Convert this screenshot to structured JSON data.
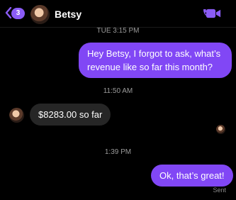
{
  "header": {
    "unread_count": "3",
    "contact_name": "Betsy"
  },
  "messages": [
    {
      "type": "timestamp",
      "text": "TUE 3:15 PM"
    },
    {
      "type": "outgoing",
      "text": "Hey Betsy, I forgot to ask, what’s revenue like so far this month?"
    },
    {
      "type": "timestamp",
      "text": "11:50 AM"
    },
    {
      "type": "incoming",
      "text": "$8283.00 so far"
    },
    {
      "type": "timestamp",
      "text": "1:39 PM"
    },
    {
      "type": "outgoing",
      "text": "Ok, that’s great!"
    }
  ],
  "status": {
    "sent_label": "Sent"
  },
  "colors": {
    "accent": "#8147f5",
    "incoming_bubble": "#262626",
    "background": "#000000"
  },
  "icons": [
    "back-chevron-icon",
    "phone-icon",
    "video-camera-icon"
  ]
}
